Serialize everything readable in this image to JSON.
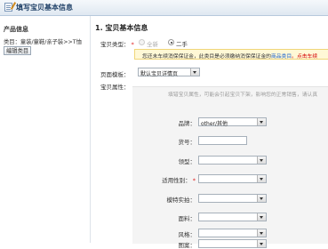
{
  "header": {
    "title": "填写宝贝基本信息",
    "icon": "edit-form-icon"
  },
  "sidebar": {
    "title": "产品信息",
    "category": "类目：童装/童鞋/亲子装>>T恤",
    "edit_button": "编辑类目"
  },
  "main": {
    "section_title": "1. 宝贝基本信息",
    "item_type": {
      "label": "宝贝类型：",
      "required_mark": "*",
      "options": [
        {
          "label": "全新",
          "checked": false,
          "disabled": true
        },
        {
          "label": "二手",
          "checked": true,
          "disabled": false
        }
      ]
    },
    "notice": {
      "text_before": "您还未车续消保保证金，此类目是必须缴纳消保保证金的",
      "link_text": "商品类目",
      "text_after": "。点击车续"
    },
    "template": {
      "label": "页面模板：",
      "value": "默认宝贝详情页"
    },
    "attributes": {
      "label": "宝贝属性：",
      "hint": "填错宝贝属性，可能会引起宝贝下架，影响您的正常销售，请认真",
      "fields": [
        {
          "label": "品牌：",
          "type": "select",
          "value": "other/其他",
          "required": false
        },
        {
          "label": "货号：",
          "type": "text",
          "value": "",
          "required": false
        },
        {
          "label": "领型：",
          "type": "select",
          "value": "",
          "required": false
        },
        {
          "label": "适用性别：",
          "type": "select",
          "value": "",
          "required": true
        },
        {
          "label": "模特实拍：",
          "type": "select",
          "value": "",
          "required": false
        },
        {
          "label": "面料：",
          "type": "select",
          "value": "",
          "required": false
        },
        {
          "label": "风格：",
          "type": "select",
          "value": "",
          "required": false
        },
        {
          "label": "图案：",
          "type": "select",
          "value": "",
          "required": false
        }
      ]
    }
  }
}
